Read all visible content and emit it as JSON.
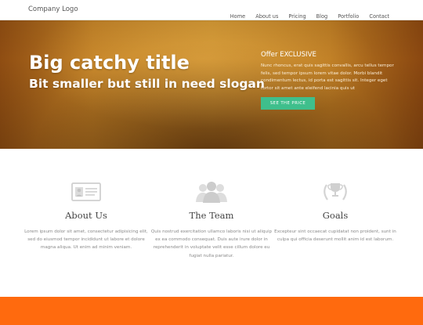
{
  "brand": {
    "logo": "Company Logo"
  },
  "nav": {
    "items": [
      "Home",
      "About us",
      "Pricing",
      "Blog",
      "Portfolio",
      "Contact"
    ]
  },
  "hero": {
    "title": "Big catchy title",
    "slogan": "Bit smaller but still in need slogan",
    "offer_title": "Offer EXCLUSIVE",
    "offer_text": "Nunc rhoncus, erat quis sagittis convallis, arcu tellus tempor felis, sed tempor ipsum lorem vitae dolor. Morbi blandit condimentum lectus, id porta est sagittis sit. Integer eget tortor sit amet ante eleifend lacinia quis ut",
    "cta_label": "SEE THE PRICE"
  },
  "features": [
    {
      "icon": "id-card-icon",
      "title": "About Us",
      "text": "Lorem ipsum dolor sit amet, consectetur adipisicing elit, sed do eiusmod tempor incididunt ut labore et dolore magna aliqua. Ut enim ad minim veniam."
    },
    {
      "icon": "team-icon",
      "title": "The Team",
      "text": "Quis nostrud exercitation ullamco laboris nisi ut aliquip ex ea commodo consequat. Duis aute irure dolor in reprehenderit in voluptate velit esse cillum dolore eu fugiat nulla pariatur."
    },
    {
      "icon": "trophy-icon",
      "title": "Goals",
      "text": "Excepteur sint occaecat cupidatat non proident, sunt in culpa qui officia deserunt mollit anim id est laborum."
    }
  ],
  "colors": {
    "accent_green": "#3fbf8c",
    "band_orange": "#ff6a0e"
  }
}
